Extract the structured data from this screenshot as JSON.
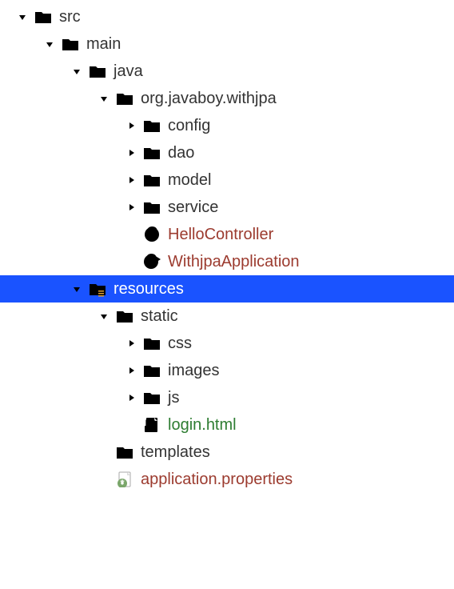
{
  "tree": {
    "src": {
      "label": "src"
    },
    "main": {
      "label": "main"
    },
    "java": {
      "label": "java"
    },
    "pkg": {
      "label": "org.javaboy.withjpa"
    },
    "config": {
      "label": "config"
    },
    "dao": {
      "label": "dao"
    },
    "model": {
      "label": "model"
    },
    "service": {
      "label": "service"
    },
    "hello": {
      "label": "HelloController"
    },
    "app": {
      "label": "WithjpaApplication"
    },
    "resources": {
      "label": "resources"
    },
    "static": {
      "label": "static"
    },
    "css": {
      "label": "css"
    },
    "images": {
      "label": "images"
    },
    "js": {
      "label": "js"
    },
    "login": {
      "label": "login.html"
    },
    "templates": {
      "label": "templates"
    },
    "appprops": {
      "label": "application.properties"
    }
  }
}
